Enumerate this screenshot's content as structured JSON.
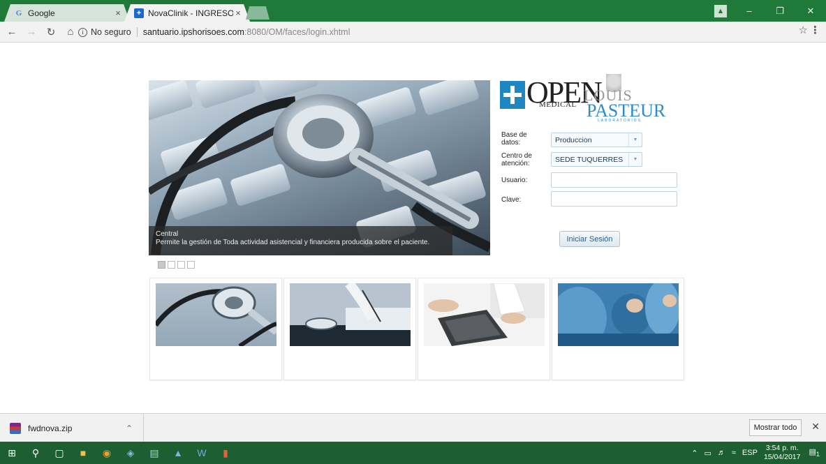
{
  "browser": {
    "tabs": [
      {
        "title": "Google",
        "favicon": "google-g-icon",
        "active": false
      },
      {
        "title": "NovaClinik - INGRESO",
        "favicon": "novaclinik-icon",
        "active": true
      }
    ],
    "tab_close_glyph": "×",
    "security_label": "No seguro",
    "url_host": "santuario.ipshorisoes.com",
    "url_rest": ":8080/OM/faces/login.xhtml"
  },
  "logo": {
    "open": "OPEN",
    "medical": "MEDICAL",
    "louis": "LOUIS",
    "pasteur": "PASTEUR",
    "lab": "LABORATORIOS"
  },
  "slider": {
    "caption_title": "Central",
    "caption_text": "Permite la gestión de Toda actividad asistencial y financiera producida sobre el paciente.",
    "slides": 4,
    "active_slide": 1
  },
  "login": {
    "db_label": "Base de datos:",
    "db_value": "Produccion",
    "center_label": "Centro de atención:",
    "center_value": "SEDE TUQUERRES",
    "user_label": "Usuario:",
    "user_value": "",
    "password_label": "Clave:",
    "password_value": "",
    "submit_label": "Iniciar Sesión"
  },
  "download_bar": {
    "file_name": "fwdnova.zip",
    "show_all_label": "Mostrar todo"
  },
  "taskbar": {
    "language": "ESP",
    "time": "3:54 p. m.",
    "date": "15/04/2017",
    "notification_count": "1"
  },
  "colors": {
    "chrome_frame": "#1f7a3a",
    "taskbar": "#1e5f32",
    "brand_blue": "#1f86c4",
    "button_text": "#2a5d86"
  }
}
